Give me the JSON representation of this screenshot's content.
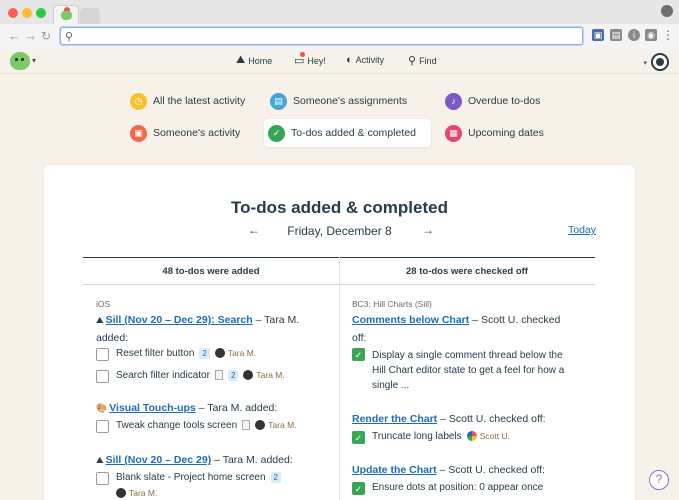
{
  "browser": {
    "address_value": "",
    "address_placeholder": ""
  },
  "nav": {
    "items": [
      {
        "label": "Home",
        "icon": "mountain-icon"
      },
      {
        "label": "Hey!",
        "icon": "hey-icon"
      },
      {
        "label": "Activity",
        "icon": "activity-icon"
      },
      {
        "label": "Find",
        "icon": "search-icon"
      }
    ]
  },
  "filters": [
    {
      "label": "All the latest activity",
      "icon": "clock-icon",
      "color": "#f4c22b"
    },
    {
      "label": "Someone's assignments",
      "icon": "assignment-icon",
      "color": "#45a6d6"
    },
    {
      "label": "Overdue to-dos",
      "icon": "bell-icon",
      "color": "#7a5cc4"
    },
    {
      "label": "Someone's activity",
      "icon": "briefcase-icon",
      "color": "#f2694a"
    },
    {
      "label": "To-dos added & completed",
      "icon": "check-icon",
      "color": "#3aa457",
      "active": true
    },
    {
      "label": "Upcoming dates",
      "icon": "calendar-icon",
      "color": "#e8446c"
    }
  ],
  "report": {
    "title": "To-dos added & completed",
    "prev_arrow": "←",
    "next_arrow": "→",
    "date": "Friday, December 8",
    "today_label": "Today",
    "added_header": "48 to-dos were added",
    "checked_header": "28 to-dos were checked off"
  },
  "added": {
    "project": "iOS",
    "groups": [
      {
        "list": "Sill (Nov 20 – Dec 29): Search",
        "suffix": " – Tara M.",
        "action": "added:",
        "todos": [
          {
            "text": "Reset filter button",
            "badge": "2",
            "person": "Tara M."
          },
          {
            "text": "Search filter indicator",
            "badge": "2",
            "person": "Tara M."
          }
        ]
      },
      {
        "list": "Visual Touch-ups",
        "suffix": " – Tara M. added:",
        "todos": [
          {
            "text": "Tweak change tools screen",
            "person": "Tara M."
          }
        ]
      },
      {
        "list": "Sill (Nov 20 – Dec 29)",
        "suffix": " – Tara M. added:",
        "todos": [
          {
            "text": "Blank slate - Project home screen",
            "badge": "2",
            "person": "Tara M."
          }
        ]
      }
    ]
  },
  "checked": {
    "project": "BC3: Hill Charts (Sill)",
    "groups": [
      {
        "list": "Comments below Chart",
        "suffix": " – Scott U. checked",
        "action": "off:",
        "todos": [
          {
            "text": "Display a single comment thread below the",
            "text2": "Hill Chart editor state to get a feel for how a",
            "text3": "single ..."
          }
        ]
      },
      {
        "list": "Render the Chart",
        "suffix": " – Scott U. checked off:",
        "todos": [
          {
            "text": "Truncate long labels",
            "person": "Scott U."
          }
        ]
      },
      {
        "list": "Update the Chart",
        "suffix": " – Scott U. checked off:",
        "todos": [
          {
            "text": "Ensure dots at position: 0 appear once"
          }
        ]
      }
    ]
  },
  "help_label": "?"
}
